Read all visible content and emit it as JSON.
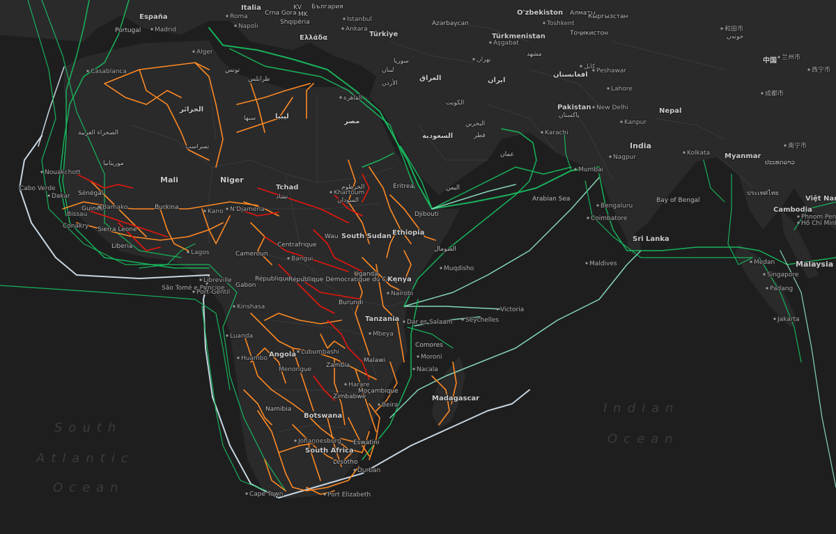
{
  "map": {
    "colors": {
      "background": "#1e1e1f",
      "land": "#2a2a2b",
      "border": "#3a3a3c",
      "terrestrial_operational": "#ff8a24",
      "terrestrial_planned": "#e8160c",
      "submarine_cable": "#18c060",
      "submarine_cable_light": "#8fe6c4",
      "submarine_cable_pale": "#d6e6f2"
    },
    "oceans": {
      "south_atlantic": [
        "South",
        "Atlantic",
        "Ocean"
      ],
      "indian": [
        "Indian",
        "Ocean"
      ]
    },
    "labels": [
      {
        "id": "espana",
        "text": "España"
      },
      {
        "id": "portugal",
        "text": "Portugal"
      },
      {
        "id": "madrid",
        "text": "Madrid"
      },
      {
        "id": "italia",
        "text": "Italia"
      },
      {
        "id": "roma",
        "text": "Roma"
      },
      {
        "id": "napoli",
        "text": "Napoli"
      },
      {
        "id": "kv",
        "text": "KV"
      },
      {
        "id": "crna_gora",
        "text": "Crna Gora"
      },
      {
        "id": "mk",
        "text": "MK"
      },
      {
        "id": "shqiperia",
        "text": "Shqipëria"
      },
      {
        "id": "bulgaria",
        "text": "България"
      },
      {
        "id": "ellada",
        "text": "Ελλάδα"
      },
      {
        "id": "istanbul",
        "text": "İstanbul"
      },
      {
        "id": "ankara",
        "text": "Ankara"
      },
      {
        "id": "turkiye",
        "text": "Türkiye"
      },
      {
        "id": "azerbaycan",
        "text": "Azərbaycan"
      },
      {
        "id": "ozbekiston",
        "text": "O'zbekiston"
      },
      {
        "id": "almaty",
        "text": "Алматы"
      },
      {
        "id": "kyrgyzstan",
        "text": "Кыргызстан"
      },
      {
        "id": "toshkent",
        "text": "Toshkent"
      },
      {
        "id": "tojikiston",
        "text": "Тоҷикистон"
      },
      {
        "id": "turkmenistan",
        "text": "Türkmenistan"
      },
      {
        "id": "asgabat",
        "text": "Aşgabat"
      },
      {
        "id": "hetian",
        "text": "和田市"
      },
      {
        "id": "hotan",
        "text": "خوتەن"
      },
      {
        "id": "lanzhou",
        "text": "兰州市"
      },
      {
        "id": "xining",
        "text": "西宁市"
      },
      {
        "id": "china",
        "text": "中国"
      },
      {
        "id": "chengdu",
        "text": "成都市"
      },
      {
        "id": "alger",
        "text": "Alger"
      },
      {
        "id": "tunis",
        "text": "تونس"
      },
      {
        "id": "tarabulus",
        "text": "طرابلس"
      },
      {
        "id": "libya",
        "text": "ليبيا"
      },
      {
        "id": "sabha",
        "text": "سبها"
      },
      {
        "id": "algeria",
        "text": "الجزائر"
      },
      {
        "id": "tamanrasset",
        "text": "تمنراست"
      },
      {
        "id": "casablanca",
        "text": "Casablanca"
      },
      {
        "id": "western_sahara",
        "text": "الصحراء الغربية"
      },
      {
        "id": "mauritania",
        "text": "موريتانيا"
      },
      {
        "id": "nouakchott",
        "text": "Nouakchott"
      },
      {
        "id": "cabo_verde",
        "text": "Cabo Verde"
      },
      {
        "id": "dakar",
        "text": "Dakar"
      },
      {
        "id": "senegal",
        "text": "Sénégal"
      },
      {
        "id": "guinee",
        "text": "Guinée"
      },
      {
        "id": "bissau",
        "text": "Bissau"
      },
      {
        "id": "conakry",
        "text": "Conakry"
      },
      {
        "id": "sierra_leone",
        "text": "Sierra Leone"
      },
      {
        "id": "liberia",
        "text": "Liberia"
      },
      {
        "id": "bamako",
        "text": "Bamako"
      },
      {
        "id": "mali",
        "text": "Mali"
      },
      {
        "id": "burkina",
        "text": "Burkina"
      },
      {
        "id": "niger",
        "text": "Niger"
      },
      {
        "id": "kano",
        "text": "Kano"
      },
      {
        "id": "njamena",
        "text": "N'Djamena"
      },
      {
        "id": "tchad",
        "text": "Tchad"
      },
      {
        "id": "tchad_ar",
        "text": "تشاد"
      },
      {
        "id": "lagos",
        "text": "Lagos"
      },
      {
        "id": "cameroun",
        "text": "Cameroun"
      },
      {
        "id": "centrafrique",
        "text": "Centrafrique"
      },
      {
        "id": "bangui",
        "text": "Bangui"
      },
      {
        "id": "cairo",
        "text": "القاهرة"
      },
      {
        "id": "egypt",
        "text": "مصر"
      },
      {
        "id": "khartoum",
        "text": "Khartoum"
      },
      {
        "id": "khartoum_ar",
        "text": "الخرطوم"
      },
      {
        "id": "sudan_ar",
        "text": "السودان"
      },
      {
        "id": "eritrea",
        "text": "Eritrea"
      },
      {
        "id": "djibouti",
        "text": "Djibouti"
      },
      {
        "id": "ethiopia",
        "text": "Ethiopia"
      },
      {
        "id": "somalia",
        "text": "الصومال"
      },
      {
        "id": "mogadishu",
        "text": "Muqdisho"
      },
      {
        "id": "wau",
        "text": "Wau"
      },
      {
        "id": "south_sudan",
        "text": "South Sudan"
      },
      {
        "id": "sao_tome",
        "text": "São Tomé e Príncipe"
      },
      {
        "id": "libreville",
        "text": "Libreville"
      },
      {
        "id": "gabon",
        "text": "Gabon"
      },
      {
        "id": "port_gentil",
        "text": "Port-Gentil"
      },
      {
        "id": "congo_rep",
        "text": "République du Congo"
      },
      {
        "id": "rdc",
        "text": "République Démocratique du Congo"
      },
      {
        "id": "kinshasa",
        "text": "Kinshasa"
      },
      {
        "id": "uganda",
        "text": "Uganda"
      },
      {
        "id": "kenya",
        "text": "Kenya"
      },
      {
        "id": "nairobi",
        "text": "Nairobi"
      },
      {
        "id": "burundi",
        "text": "Burundi"
      },
      {
        "id": "tanzania",
        "text": "Tanzania"
      },
      {
        "id": "dar_es_salaam",
        "text": "Dar es Salaam"
      },
      {
        "id": "luanda",
        "text": "Luanda"
      },
      {
        "id": "angola",
        "text": "Angola"
      },
      {
        "id": "huambo",
        "text": "Huambo"
      },
      {
        "id": "menongue",
        "text": "Menongue"
      },
      {
        "id": "lubumbashi",
        "text": "Lubumbashi"
      },
      {
        "id": "zambia",
        "text": "Zambia"
      },
      {
        "id": "mbeya",
        "text": "Mbeya"
      },
      {
        "id": "malawi",
        "text": "Malawi"
      },
      {
        "id": "harare",
        "text": "Harare"
      },
      {
        "id": "zimbabwe",
        "text": "Zimbabwe"
      },
      {
        "id": "mocambique",
        "text": "Moçambique"
      },
      {
        "id": "beira",
        "text": "Beira"
      },
      {
        "id": "nacala",
        "text": "Nacala"
      },
      {
        "id": "comores",
        "text": "Comores"
      },
      {
        "id": "moroni",
        "text": "Moroni"
      },
      {
        "id": "madagascar",
        "text": "Madagascar"
      },
      {
        "id": "namibia",
        "text": "Namibia"
      },
      {
        "id": "botswana",
        "text": "Botswana"
      },
      {
        "id": "johannesburg",
        "text": "Johannesburg"
      },
      {
        "id": "south_africa",
        "text": "South Africa"
      },
      {
        "id": "eswatini",
        "text": "Eswatini"
      },
      {
        "id": "lesotho",
        "text": "Lesotho"
      },
      {
        "id": "durban",
        "text": "Durban"
      },
      {
        "id": "cape_town",
        "text": "Cape Town"
      },
      {
        "id": "port_elizabeth",
        "text": "Port Elizabeth"
      },
      {
        "id": "seychelles",
        "text": "Seychelles"
      },
      {
        "id": "victoria",
        "text": "Victoria"
      },
      {
        "id": "maldives",
        "text": "Maldives"
      },
      {
        "id": "suriya",
        "text": "سوريا"
      },
      {
        "id": "lubnan",
        "text": "لبنان"
      },
      {
        "id": "al_urdun",
        "text": "الأردن"
      },
      {
        "id": "iraq",
        "text": "العراق"
      },
      {
        "id": "iran",
        "text": "ایران"
      },
      {
        "id": "kuwait",
        "text": "الكويت"
      },
      {
        "id": "bahrain",
        "text": "البحرين"
      },
      {
        "id": "qatar",
        "text": "قطر"
      },
      {
        "id": "saudi",
        "text": "السعودية"
      },
      {
        "id": "oman",
        "text": "عمان"
      },
      {
        "id": "yemen",
        "text": "اليمن"
      },
      {
        "id": "mashhad",
        "text": "مشهد"
      },
      {
        "id": "tehran",
        "text": "تهران"
      },
      {
        "id": "afghanistan",
        "text": "افغانستان"
      },
      {
        "id": "kabul",
        "text": "کابل"
      },
      {
        "id": "peshawar",
        "text": "Peshawar"
      },
      {
        "id": "lahore",
        "text": "Lahore"
      },
      {
        "id": "pakistan",
        "text": "Pakistan"
      },
      {
        "id": "pakistan_ur",
        "text": "پاکستان"
      },
      {
        "id": "karachi",
        "text": "Karachi"
      },
      {
        "id": "new_delhi",
        "text": "New Delhi"
      },
      {
        "id": "nepal",
        "text": "Nepal"
      },
      {
        "id": "kanpur",
        "text": "Kanpur"
      },
      {
        "id": "india",
        "text": "India"
      },
      {
        "id": "nagpur",
        "text": "Nagpur"
      },
      {
        "id": "kolkata",
        "text": "Kolkata"
      },
      {
        "id": "mumbai",
        "text": "Mumbai"
      },
      {
        "id": "bengaluru",
        "text": "Bengaluru"
      },
      {
        "id": "coimbatore",
        "text": "Coimbatore"
      },
      {
        "id": "sri_lanka",
        "text": "Sri Lanka"
      },
      {
        "id": "myanmar",
        "text": "Myanmar"
      },
      {
        "id": "nanning",
        "text": "南宁市"
      },
      {
        "id": "laos",
        "text": "ປະເທດລາວ"
      },
      {
        "id": "thailand",
        "text": "ประเทศไทย"
      },
      {
        "id": "viet_nam",
        "text": "Việt Nam"
      },
      {
        "id": "cambodia",
        "text": "Cambodia"
      },
      {
        "id": "phnom_penh",
        "text": "Phnom Penh"
      },
      {
        "id": "ho_chi_minh",
        "text": "Hồ Chí Minh"
      },
      {
        "id": "medan",
        "text": "Medan"
      },
      {
        "id": "malaysia",
        "text": "Malaysia"
      },
      {
        "id": "singapore",
        "text": "Singapore"
      },
      {
        "id": "padang",
        "text": "Padang"
      },
      {
        "id": "jakarta",
        "text": "Jakarta"
      },
      {
        "id": "arabian_sea",
        "text": "Arabian Sea"
      },
      {
        "id": "bay_of_bengal",
        "text": "Bay of Bengal"
      }
    ]
  }
}
